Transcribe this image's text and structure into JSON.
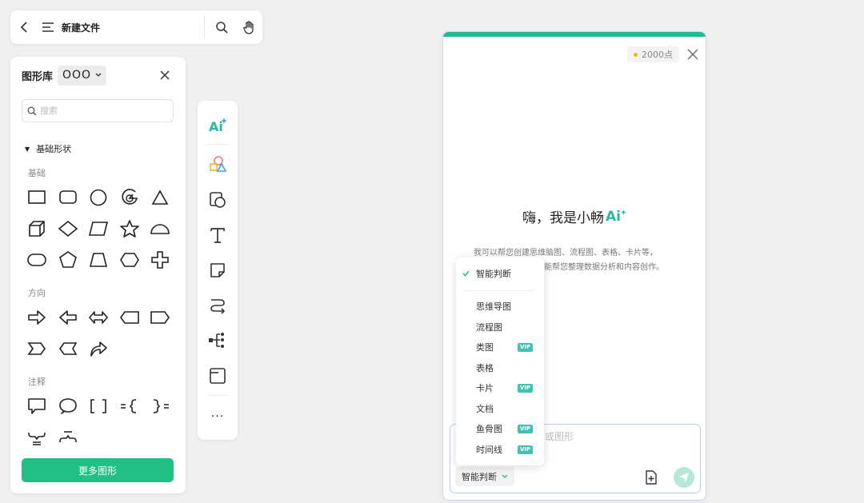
{
  "topbar": {
    "title": "新建文件"
  },
  "library": {
    "title": "图形库",
    "select_value": "OOO",
    "search_placeholder": "搜索",
    "section_title": "基础形状",
    "groups": {
      "basic": "基础",
      "direction": "方向",
      "annotation": "注释"
    },
    "more_button": "更多图形"
  },
  "toolbar": {
    "ai_label": "Ai",
    "text_label": "T",
    "more_label": "···"
  },
  "ai_panel": {
    "points": "2000点",
    "greeting": "嗨，我是小畅",
    "ai_mark": "Ai",
    "intro_line1": "我可以帮您创建思维脑图、流程图、表格、卡片等，",
    "intro_line2": "还能帮您整理数据分析和内容创作。",
    "input_placeholder": "或图形",
    "mode": "智能判断"
  },
  "dropdown": {
    "selected": "智能判断",
    "items": [
      {
        "label": "思维导图",
        "vip": ""
      },
      {
        "label": "流程图",
        "vip": ""
      },
      {
        "label": "类图",
        "vip": "VIP"
      },
      {
        "label": "表格",
        "vip": ""
      },
      {
        "label": "卡片",
        "vip": "VIP"
      },
      {
        "label": "文档",
        "vip": ""
      },
      {
        "label": "鱼骨图",
        "vip": "VIP"
      },
      {
        "label": "时间线",
        "vip": "VIP"
      }
    ]
  },
  "colors": {
    "accent": "#21c085",
    "ai_teal": "#2ab8a6",
    "vip": "#3fc3b0",
    "panel_border": "#c7d9ef"
  }
}
